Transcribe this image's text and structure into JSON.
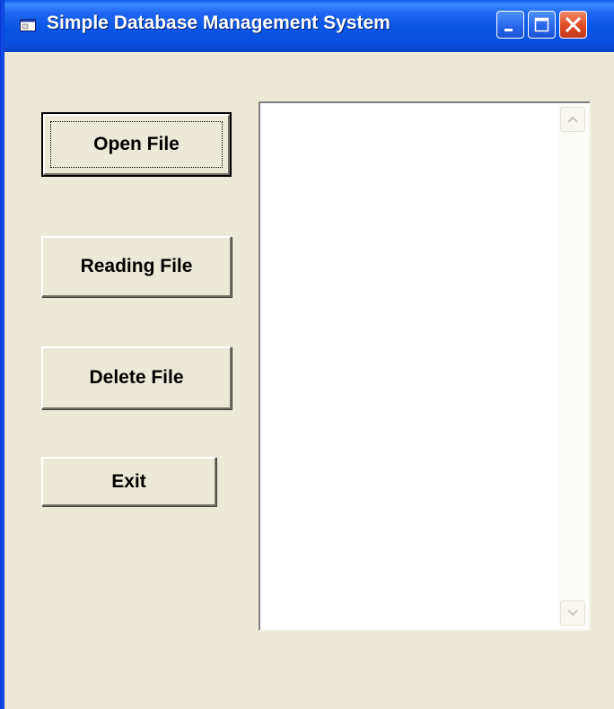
{
  "window": {
    "title": "Simple Database Management System",
    "icon": "app-window-icon"
  },
  "titlebar_controls": {
    "minimize_icon": "minimize-icon",
    "maximize_icon": "maximize-icon",
    "close_icon": "close-icon"
  },
  "buttons": {
    "open_file": "Open File",
    "reading_file": "Reading File",
    "delete_file": "Delete File",
    "exit": "Exit"
  },
  "listbox": {
    "items": [],
    "scroll_up_icon": "chevron-up-icon",
    "scroll_down_icon": "chevron-down-icon"
  },
  "colors": {
    "titlebar": "#0A58E9",
    "window_face": "#ECE9D8",
    "close_button": "#DD4A22"
  }
}
